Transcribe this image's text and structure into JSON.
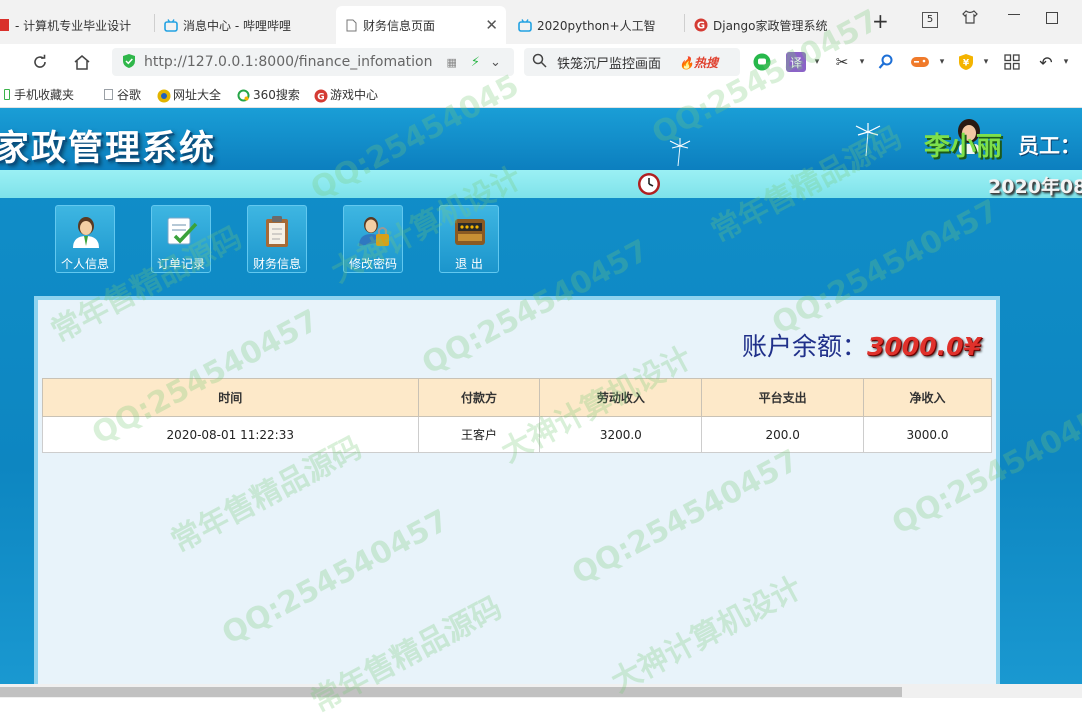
{
  "browser": {
    "tabs": [
      {
        "label": "- 计算机专业毕业设计",
        "active": false
      },
      {
        "label": "消息中心 - 哔哩哔哩",
        "active": false
      },
      {
        "label": "财务信息页面",
        "active": true
      },
      {
        "label": "2020python+人工智",
        "active": false
      },
      {
        "label": "Django家政管理系统",
        "active": false
      }
    ],
    "new_tab": "+",
    "window_badge": "5",
    "url": "http://127.0.0.1:8000/finance_infomation",
    "search_text": "铁笼沉尸监控画面",
    "hot_label": "热搜",
    "translate_label": "译"
  },
  "bookmarks": [
    {
      "label": "手机收藏夹",
      "color": "#3bb34a"
    },
    {
      "label": "谷歌",
      "color": "#9aa0a6"
    },
    {
      "label": "网址大全",
      "color": "#e2b400"
    },
    {
      "label": "360搜索",
      "color": "#26a547"
    },
    {
      "label": "游戏中心",
      "color": "#d43b33"
    }
  ],
  "header": {
    "site_title": "家政管理系统",
    "user_name": "李小丽",
    "user_role": "员工：",
    "date_text": "2020年08"
  },
  "menu": [
    {
      "label": "个人信息",
      "icon": "user-icon"
    },
    {
      "label": "订单记录",
      "icon": "order-icon"
    },
    {
      "label": "财务信息",
      "icon": "clipboard-icon"
    },
    {
      "label": "修改密码",
      "icon": "lock-user-icon"
    },
    {
      "label": "退  出",
      "icon": "exit-icon"
    }
  ],
  "finance": {
    "balance_label": "账户余额：",
    "balance_value": "3000.0¥",
    "columns": [
      "时间",
      "付款方",
      "劳动收入",
      "平台支出",
      "净收入"
    ],
    "rows": [
      [
        "2020-08-01 11:22:33",
        "王客户",
        "3200.0",
        "200.0",
        "3000.0"
      ]
    ]
  },
  "watermark": [
    "QQ:25454045",
    "常年售精品源码",
    "大神计算机设计",
    "QQ:254540457"
  ],
  "colors": {
    "accent_blue": "#118fca",
    "title_red": "#e0312b",
    "table_header": "#fde9c9",
    "name_green": "#7ee04a"
  }
}
